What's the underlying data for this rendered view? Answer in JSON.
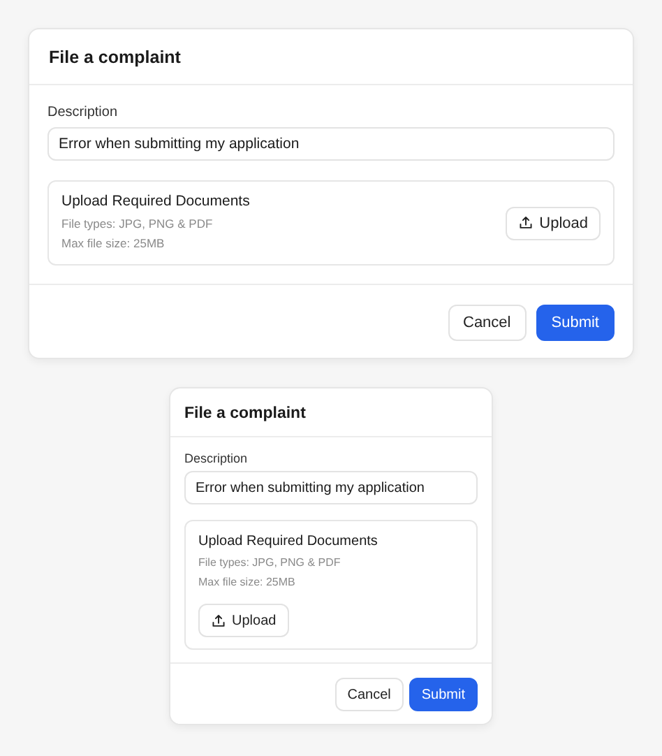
{
  "dialogs": [
    {
      "compact": false,
      "title": "File a complaint",
      "field": {
        "label": "Description",
        "value": "Error when submitting my application"
      },
      "upload": {
        "title": "Upload Required Documents",
        "notes": [
          "File types: JPG, PNG & PDF",
          "Max file size: 25MB"
        ],
        "button": "Upload"
      },
      "buttons": [
        {
          "label": "Cancel",
          "kind": "secondary"
        },
        {
          "label": "Submit",
          "kind": "primary"
        }
      ]
    },
    {
      "compact": true,
      "title": "File a complaint",
      "field": {
        "label": "Description",
        "value": "Error when submitting my application"
      },
      "upload": {
        "title": "Upload Required Documents",
        "notes": [
          "File types: JPG, PNG & PDF",
          "Max file size: 25MB"
        ],
        "button": "Upload"
      },
      "buttons": [
        {
          "label": "Cancel",
          "kind": "secondary"
        },
        {
          "label": "Submit",
          "kind": "primary"
        }
      ]
    }
  ]
}
